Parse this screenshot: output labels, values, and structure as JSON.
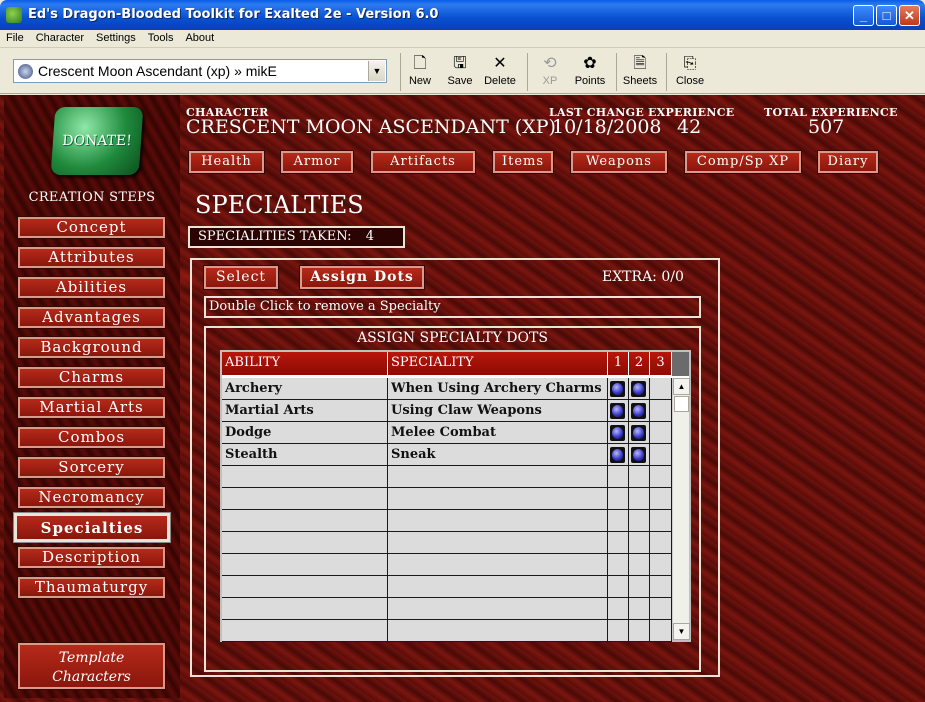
{
  "window": {
    "title": "Ed's Dragon-Blooded Toolkit for Exalted 2e - Version 6.0"
  },
  "menu": [
    "File",
    "Character",
    "Settings",
    "Tools",
    "About"
  ],
  "toolbar": {
    "character_select": "Crescent Moon Ascendant (xp) » mikE",
    "buttons": [
      {
        "label": "New",
        "icon": "new-document-icon"
      },
      {
        "label": "Save",
        "icon": "floppy-disk-icon"
      },
      {
        "label": "Delete",
        "icon": "x-delete-icon"
      },
      {
        "label": "XP",
        "icon": "xp-icon",
        "disabled": true
      },
      {
        "label": "Points",
        "icon": "points-icon"
      },
      {
        "label": "Sheets",
        "icon": "sheets-icon"
      },
      {
        "label": "Close",
        "icon": "close-door-icon"
      }
    ]
  },
  "sidebar": {
    "donate": "DONATE!",
    "steps_title": "CREATION STEPS",
    "steps": [
      "Concept",
      "Attributes",
      "Abilities",
      "Advantages",
      "Background",
      "Charms",
      "Martial Arts",
      "Combos",
      "Sorcery",
      "Necromancy",
      "Specialties",
      "Description",
      "Thaumaturgy"
    ],
    "active_step": "Specialties",
    "template": [
      "Template",
      "Characters"
    ]
  },
  "header": {
    "character_label": "CHARACTER",
    "character_name": "CRESCENT MOON ASCENDANT (XP)",
    "last_change_label": "LAST CHANGE",
    "last_change": "10/18/2008",
    "experience_label": "EXPERIENCE",
    "experience": "42",
    "total_exp_label": "TOTAL EXPERIENCE",
    "total_exp": "507",
    "buttons": [
      "Health",
      "Armor",
      "Artifacts",
      "Items",
      "Weapons",
      "Comp/Sp XP",
      "Diary"
    ]
  },
  "section": {
    "title": "SPECIALTIES",
    "taken_label": "SPECIALITIES TAKEN:",
    "taken_value": "4",
    "select_btn": "Select",
    "assign_btn": "Assign Dots",
    "extra_label": "EXTRA:",
    "extra_value": "0/0",
    "hint": "Double Click to remove a Specialty",
    "assign_title": "ASSIGN SPECIALTY DOTS",
    "columns": [
      "ABILITY",
      "SPECIALITY",
      "1",
      "2",
      "3"
    ],
    "rows": [
      {
        "ability": "Archery",
        "speciality": "When Using Archery Charms",
        "dots": 2
      },
      {
        "ability": "Martial Arts",
        "speciality": "Using Claw Weapons",
        "dots": 2
      },
      {
        "ability": "Dodge",
        "speciality": "Melee Combat",
        "dots": 2
      },
      {
        "ability": "Stealth",
        "speciality": "Sneak",
        "dots": 2
      },
      {
        "ability": "",
        "speciality": "",
        "dots": 0
      },
      {
        "ability": "",
        "speciality": "",
        "dots": 0
      },
      {
        "ability": "",
        "speciality": "",
        "dots": 0
      },
      {
        "ability": "",
        "speciality": "",
        "dots": 0
      },
      {
        "ability": "",
        "speciality": "",
        "dots": 0
      },
      {
        "ability": "",
        "speciality": "",
        "dots": 0
      },
      {
        "ability": "",
        "speciality": "",
        "dots": 0
      },
      {
        "ability": "",
        "speciality": "",
        "dots": 0
      }
    ]
  }
}
